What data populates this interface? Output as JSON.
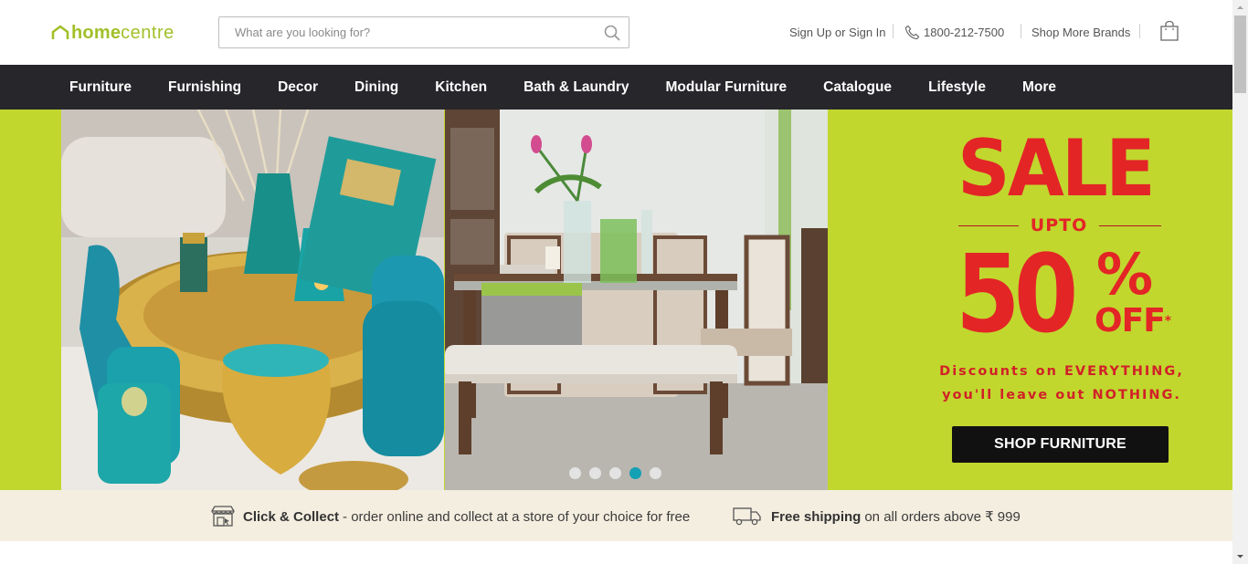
{
  "header": {
    "logo_bold": "home",
    "logo_light": "centre",
    "search_placeholder": "What are you looking for?",
    "sign_in": "Sign Up or Sign In",
    "phone": "1800-212-7500",
    "shop_more_brands": "Shop More Brands"
  },
  "nav": {
    "items": [
      "Furniture",
      "Furnishing",
      "Decor",
      "Dining",
      "Kitchen",
      "Bath & Laundry",
      "Modular Furniture",
      "Catalogue",
      "Lifestyle",
      "More"
    ]
  },
  "banner": {
    "headline": "SALE",
    "upto": "UPTO",
    "discount": "50",
    "percent": "%",
    "off": "OFF",
    "off_mark": "*",
    "subline_1": "Discounts on EVERYTHING,",
    "subline_2": "you'll leave out NOTHING.",
    "cta": "SHOP FURNITURE",
    "slides_total": 5,
    "active_slide": 4
  },
  "info_strip": {
    "collect_title": "Click & Collect",
    "collect_text": "- order online and collect at a store of your choice for free",
    "shipping_title": "Free shipping",
    "shipping_text": "on all orders above ₹ 999"
  },
  "colors": {
    "brand_green": "#a2c02a",
    "banner_bg": "#c1d72e",
    "nav_bg": "#27262b",
    "sale_red": "#e32526",
    "dot_active": "#14a0b4",
    "strip_bg": "#f4eee0"
  },
  "icons": [
    "home-roof-icon",
    "search-icon",
    "phone-icon",
    "shopping-bag-icon",
    "store-icon",
    "truck-icon"
  ]
}
